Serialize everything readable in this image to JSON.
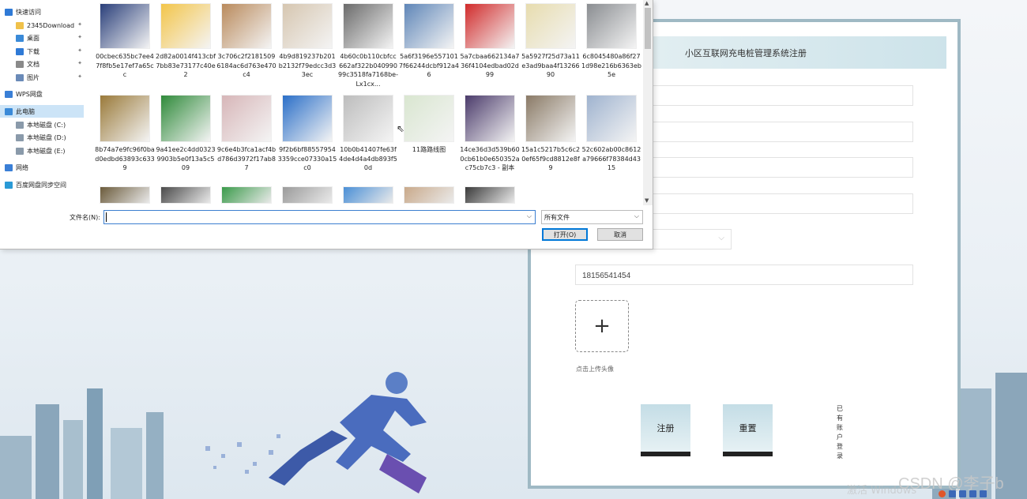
{
  "registration": {
    "title": "小区互联网充电桩管理系统注册",
    "phone_value": "18156541454",
    "upload_label": "点击上传头像",
    "register_button": "注册",
    "reset_button": "重置",
    "login_link": "已有账户登录"
  },
  "file_dialog": {
    "nav_items": [
      {
        "label": "快速访问",
        "icon": "star-icon"
      },
      {
        "label": "2345Download",
        "icon": "folder-icon"
      },
      {
        "label": "桌面",
        "icon": "desktop-icon"
      },
      {
        "label": "下载",
        "icon": "download-icon"
      },
      {
        "label": "文档",
        "icon": "document-icon"
      },
      {
        "label": "图片",
        "icon": "picture-icon"
      },
      {
        "label": "WPS网盘",
        "icon": "cloud-icon"
      },
      {
        "label": "此电脑",
        "icon": "computer-icon"
      },
      {
        "label": "本地磁盘 (C:)",
        "icon": "drive-icon"
      },
      {
        "label": "本地磁盘 (D:)",
        "icon": "drive-icon"
      },
      {
        "label": "本地磁盘 (E:)",
        "icon": "drive-icon"
      },
      {
        "label": "网络",
        "icon": "network-icon"
      },
      {
        "label": "百度网盘同步空间",
        "icon": "sync-icon"
      }
    ],
    "files": [
      {
        "name": "00cbec635bc7ee47f8fb5e17ef7a65cc",
        "color": "#2a3f7a"
      },
      {
        "name": "2d82a0014f413cbf7bb83e73177c40e2",
        "color": "#f3c54a"
      },
      {
        "name": "3c706c2f21815096184ac6d763e470c4",
        "color": "#b98a5c"
      },
      {
        "name": "4b9d819237b201b2132f79edcc3d33ec",
        "color": "#d6c6b0"
      },
      {
        "name": "4b60c0b110cbfcc662af322b04099099c3518fa7168be-Lx1cx...",
        "color": "#6b6b6b"
      },
      {
        "name": "5a6f3196e5571017f66244dcbf912a46",
        "color": "#5f86b8"
      },
      {
        "name": "5a7cbaa662134a736f4104edbad02d99",
        "color": "#d12b2b"
      },
      {
        "name": "5a5927f25d73a11e3ad9baa4f1326690",
        "color": "#e7dcae"
      },
      {
        "name": "6c8045480a86f271d98e216b6363eb5e",
        "color": "#8a8d91"
      },
      {
        "name": "8b74a7e9fc96f0bad0edbd63893c6339",
        "color": "#9a7a3a"
      },
      {
        "name": "9a41ee2c4dd03239903b5e0f13a5c509",
        "color": "#2f8a3a"
      },
      {
        "name": "9c6e4b3fca1acf4bd786d3972f17ab87",
        "color": "#d7b6b8"
      },
      {
        "name": "9f2b6bf885579543359cce07330a15c0",
        "color": "#2b6fc8"
      },
      {
        "name": "10b0b41407fe63f4de4d4a4db893f50d",
        "color": "#bdbdbd"
      },
      {
        "name": "11路路线图",
        "color": "#d9e6d0"
      },
      {
        "name": "14ce36d3d539b600cb61b0e650352ac75cb7c3 - 副本",
        "color": "#4b3b6b"
      },
      {
        "name": "15a1c5217b5c6c20ef65f9cd8812e8f9",
        "color": "#8a7a66"
      },
      {
        "name": "52c602ab00c8612a79666f78384d4315",
        "color": "#9fb3cf"
      }
    ],
    "partial_row_colors": [
      "#6b5b3b",
      "#4a4a4a",
      "#3a9a4a",
      "#9a9a9a",
      "#4a8fd6",
      "#c9a98a",
      "#3a3a3a"
    ],
    "filename_label": "文件名(N):",
    "filename_value": "",
    "filter_value": "所有文件",
    "open_button": "打开(O)",
    "cancel_button": "取消"
  },
  "watermark": "CSDN @李子b",
  "watermark_activate": "激活 Windows"
}
